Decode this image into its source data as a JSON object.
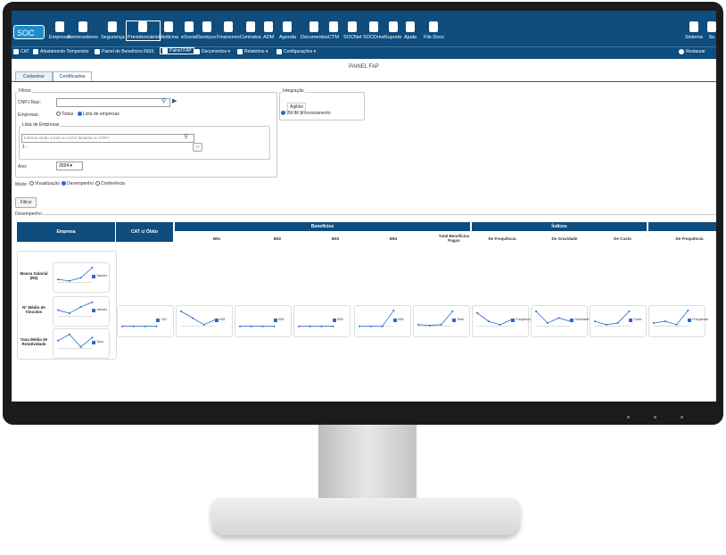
{
  "topnav": {
    "logo": "SOC",
    "items": [
      {
        "label": "Empresas"
      },
      {
        "label": "Fornecedores"
      },
      {
        "label": "Segurança"
      },
      {
        "label": "Previdenciário",
        "active": true
      },
      {
        "label": "Medicina"
      },
      {
        "label": "eSocial"
      },
      {
        "label": "Serviços"
      },
      {
        "label": "Financeiro"
      },
      {
        "label": "Contratos"
      },
      {
        "label": "ADM"
      },
      {
        "label": "Agenda"
      },
      {
        "label": "Documentos"
      },
      {
        "label": "CTM"
      },
      {
        "label": "SOCNet"
      },
      {
        "label": "SOCDrive"
      },
      {
        "label": "Suporte"
      },
      {
        "label": "Ajuda"
      },
      {
        "label": "File Docs"
      }
    ],
    "right_items": [
      {
        "label": "Sistema"
      },
      {
        "label": "Se"
      }
    ]
  },
  "subnav": {
    "items": [
      {
        "label": "CAT"
      },
      {
        "label": "Afastamento Temporário"
      },
      {
        "label": "Painel de Benefícios INSS"
      },
      {
        "label": "Painel FAP",
        "active": true
      },
      {
        "label": "Documentos ▾"
      },
      {
        "label": "Relatórios ▾"
      },
      {
        "label": "Configurações ▾"
      }
    ],
    "restore": "Restaurar"
  },
  "page_title": "PAINEL FAP",
  "tabs": [
    {
      "label": "Cadastrar"
    },
    {
      "label": "Certificados",
      "selected": true
    }
  ],
  "filtros": {
    "legend": "Filtros",
    "cnpj_label": "CNPJ Raiz:",
    "empresas_label": "Empresas:",
    "opt_todas": "Todas",
    "opt_lista": "Lista de empresas",
    "lista_legend": "Lista de Empresas",
    "search_placeholder": "Informe razão social ou nome fantasia ou CNPJ",
    "item_prefix": "1 -",
    "ano_label": "Ano:",
    "ano_value": "2024 ▾"
  },
  "integracao": {
    "legend": "Integração",
    "status": "Agilitei",
    "radio_label": "Via de processamento"
  },
  "modo": {
    "label": "Modo:",
    "options": [
      {
        "label": "Visualização"
      },
      {
        "label": "Desempenho",
        "selected": true
      },
      {
        "label": "Conferência"
      }
    ]
  },
  "filter_button": "Filtrar",
  "desempenho_legend": "Desempenho",
  "table": {
    "col_empresa": "Empresa",
    "col_cat": "CAT c/ Óbito",
    "group_beneficios": "Benefícios",
    "group_indices": "Índices",
    "sub_beneficios": [
      "B91",
      "B92",
      "B93",
      "B94",
      "Total Benefícios Pagos"
    ],
    "sub_indices": [
      "De Frequência",
      "De Gravidade",
      "De Custo",
      "De Frequência"
    ],
    "row_labels": [
      "Massa Salarial (R$)",
      "Nº Médio de Vínculos",
      "Taxa Média de Rotatividade"
    ]
  },
  "charts": {
    "legend_names": [
      "Valores",
      "Valores",
      "Taxa",
      "CAT",
      "B91",
      "B92",
      "B93",
      "B94",
      "Total",
      "Frequência",
      "Gravidade",
      "Custo",
      "Frequência"
    ],
    "years": [
      "2022",
      "2023",
      "2024"
    ]
  }
}
